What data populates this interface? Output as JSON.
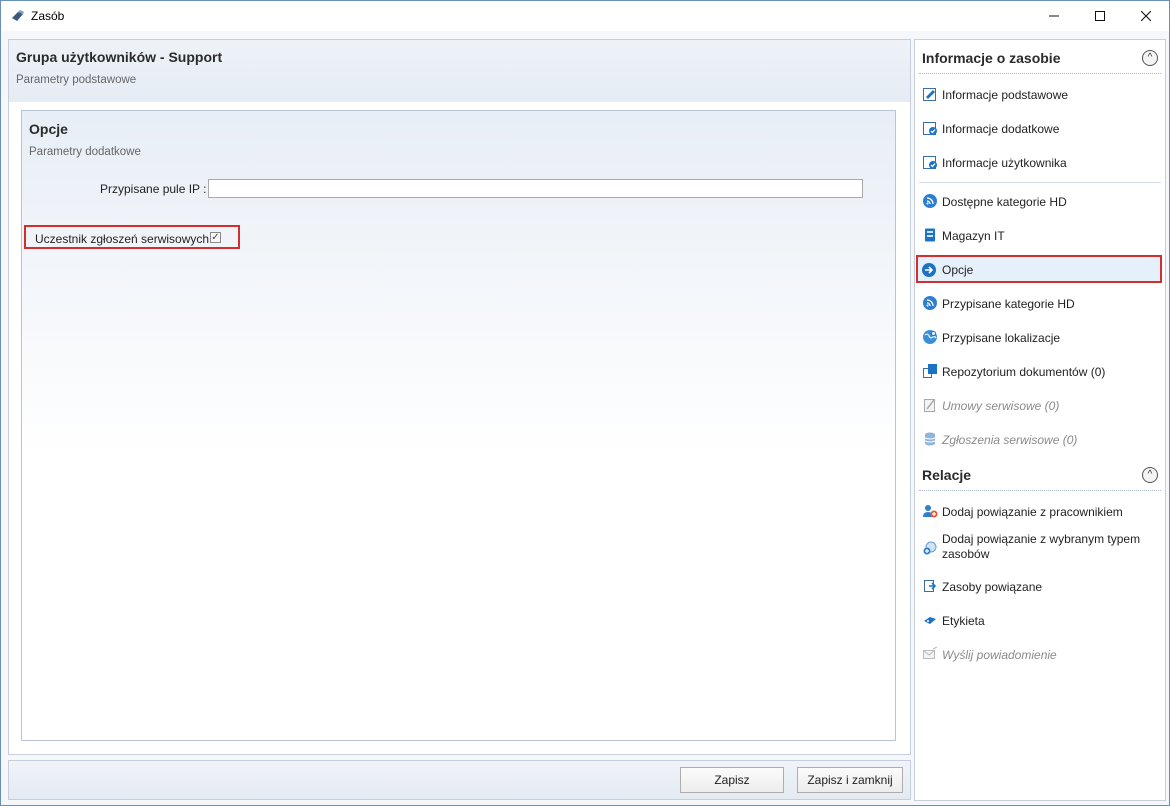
{
  "window": {
    "title": "Zasób"
  },
  "header": {
    "title": "Grupa użytkowników - Support",
    "subtitle": "Parametry podstawowe"
  },
  "card": {
    "title": "Opcje",
    "subtitle": "Parametry dodatkowe",
    "ip_label": "Przypisane pule IP :",
    "ip_value": "",
    "checkbox_label": "Uczestnik zgłoszeń serwisowych",
    "checkbox_checked": true
  },
  "footer": {
    "save_label": "Zapisz",
    "save_close_label": "Zapisz i zamknij"
  },
  "sidebar": {
    "info_title": "Informacje o zasobie",
    "info_items": [
      {
        "label": "Informacje podstawowe",
        "icon": "edit-form-icon"
      },
      {
        "label": "Informacje dodatkowe",
        "icon": "form-check-icon"
      },
      {
        "label": "Informacje użytkownika",
        "icon": "form-check-icon"
      },
      {
        "label": "Dostępne kategorie HD",
        "icon": "rss-circle-icon"
      },
      {
        "label": "Magazyn IT",
        "icon": "storage-icon"
      },
      {
        "label": "Opcje",
        "icon": "arrow-right-circle-icon",
        "selected": true
      },
      {
        "label": "Przypisane kategorie HD",
        "icon": "rss-circle-icon"
      },
      {
        "label": "Przypisane lokalizacje",
        "icon": "globe-icon"
      },
      {
        "label": "Repozytorium dokumentów (0)",
        "icon": "documents-icon"
      },
      {
        "label": "Umowy serwisowe (0)",
        "icon": "contract-icon",
        "disabled": true
      },
      {
        "label": "Zgłoszenia serwisowe (0)",
        "icon": "database-icon",
        "disabled": true
      }
    ],
    "relations_title": "Relacje",
    "relation_items": [
      {
        "label": "Dodaj powiązanie z pracownikiem",
        "icon": "add-user-icon"
      },
      {
        "label": "Dodaj powiązanie z wybranym typem zasobów",
        "icon": "add-link-icon"
      },
      {
        "label": "Zasoby powiązane",
        "icon": "linked-resources-icon"
      },
      {
        "label": "Etykieta",
        "icon": "label-icon"
      },
      {
        "label": "Wyślij powiadomienie",
        "icon": "send-mail-icon",
        "disabled": true
      }
    ]
  },
  "colors": {
    "accent": "#1c73c4",
    "highlight_border": "#d32f2f",
    "selected_bg": "#e6f0fb"
  }
}
